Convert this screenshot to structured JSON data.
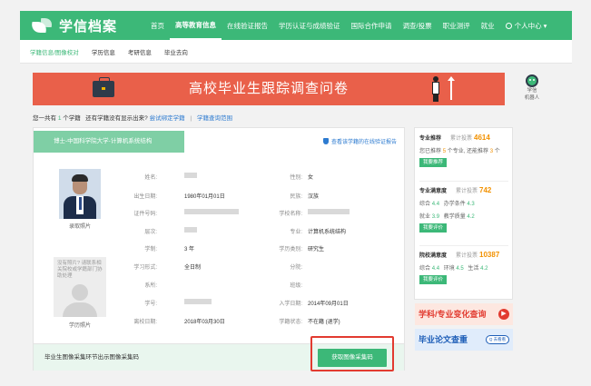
{
  "header": {
    "logo_text": "学信档案",
    "nav": [
      "首页",
      "高等教育信息",
      "在线验证报告",
      "学历认证与成绩验证",
      "国际合作申请",
      "调查/投票",
      "职业测评",
      "就业"
    ],
    "active_nav": 1,
    "user_menu": "个人中心 ▾"
  },
  "subnav": {
    "items": [
      "学籍信息/图像校对",
      "学历信息",
      "考研信息",
      "毕业去向"
    ],
    "active": 0
  },
  "banner": {
    "title": "高校毕业生跟踪调查问卷"
  },
  "robot": {
    "label_line1": "学信",
    "label_line2": "机器人"
  },
  "summary": {
    "prefix": "您一共有",
    "count": "1",
    "suffix": "个学籍",
    "question": "还有学籍没有显示出来?",
    "link1": "尝试绑定学籍",
    "separator": "|",
    "link2": "学籍查询范围"
  },
  "record": {
    "tab_title": "博士-中国科学院大学-计算机系统结构",
    "verify_link": "查看该学籍的在线验证报告",
    "photo1_label": "录取照片",
    "photo2_text": "没有照片? 请联系相关院校或学籍部门协助处理",
    "photo2_label": "学历照片",
    "fields": {
      "name_label": "姓名:",
      "gender_label": "性别:",
      "gender_value": "女",
      "birth_label": "出生日期:",
      "birth_value": "1980年01月01日",
      "ethnic_label": "民族:",
      "ethnic_value": "汉族",
      "id_label": "证件号码:",
      "school_label": "学校名称:",
      "level_label": "层次:",
      "major_label": "专业:",
      "major_value": "计算机系统结构",
      "length_label": "学制:",
      "length_value": "3 年",
      "type_label": "学历类别:",
      "type_value": "研究生",
      "form_label": "学习形式:",
      "form_value": "全日制",
      "branch_label": "分院:",
      "dept_label": "系所:",
      "class_label": "班级:",
      "sid_label": "学号:",
      "enroll_label": "入学日期:",
      "enroll_value": "2014年09月01日",
      "leave_label": "离校日期:",
      "leave_value": "2018年03月30日",
      "status_label": "学籍状态:",
      "status_value": "不在籍 (退学)"
    },
    "footer_text": "毕业生图像采集环节出示图像采集码",
    "footer_button": "获取图像采集码"
  },
  "side": {
    "major_rec_title": "专业推荐",
    "major_rec_sub": "累计投票",
    "major_rec_votes": "4614",
    "major_rec_line_a": "您已推荐",
    "major_rec_count": "5",
    "major_rec_line_b": "个专业, 还能推荐",
    "major_rec_remaining": "3",
    "major_rec_line_c": "个",
    "major_rec_btn": "我要推荐",
    "major_sat_title": "专业满意度",
    "major_sat_sub": "累计投票",
    "major_sat_votes": "742",
    "major_sat_l1": "综合",
    "major_sat_v1": "4.4",
    "major_sat_l2": "办学条件",
    "major_sat_v2": "4.3",
    "major_sat_l3": "就业",
    "major_sat_v3": "3.9",
    "major_sat_l4": "教学质量",
    "major_sat_v4": "4.2",
    "major_sat_btn": "我要评价",
    "school_sat_title": "院校满意度",
    "school_sat_sub": "累计投票",
    "school_sat_votes": "10387",
    "school_sat_l1": "综合",
    "school_sat_v1": "4.4",
    "school_sat_l2": "环境",
    "school_sat_v2": "4.5",
    "school_sat_l3": "生活",
    "school_sat_v3": "4.2",
    "school_sat_btn": "我要评价",
    "ad1_text": "学科/专业变化查询",
    "ad1_icon": "▶",
    "ad2_text": "毕业论文查重",
    "ad2_search": "Q 去看看"
  },
  "colors": {
    "brand_green": "#3cb878",
    "banner_red": "#e9604a",
    "highlight_red": "#e23b30",
    "link_blue": "#2d7bd0",
    "vote_orange": "#f29100"
  }
}
